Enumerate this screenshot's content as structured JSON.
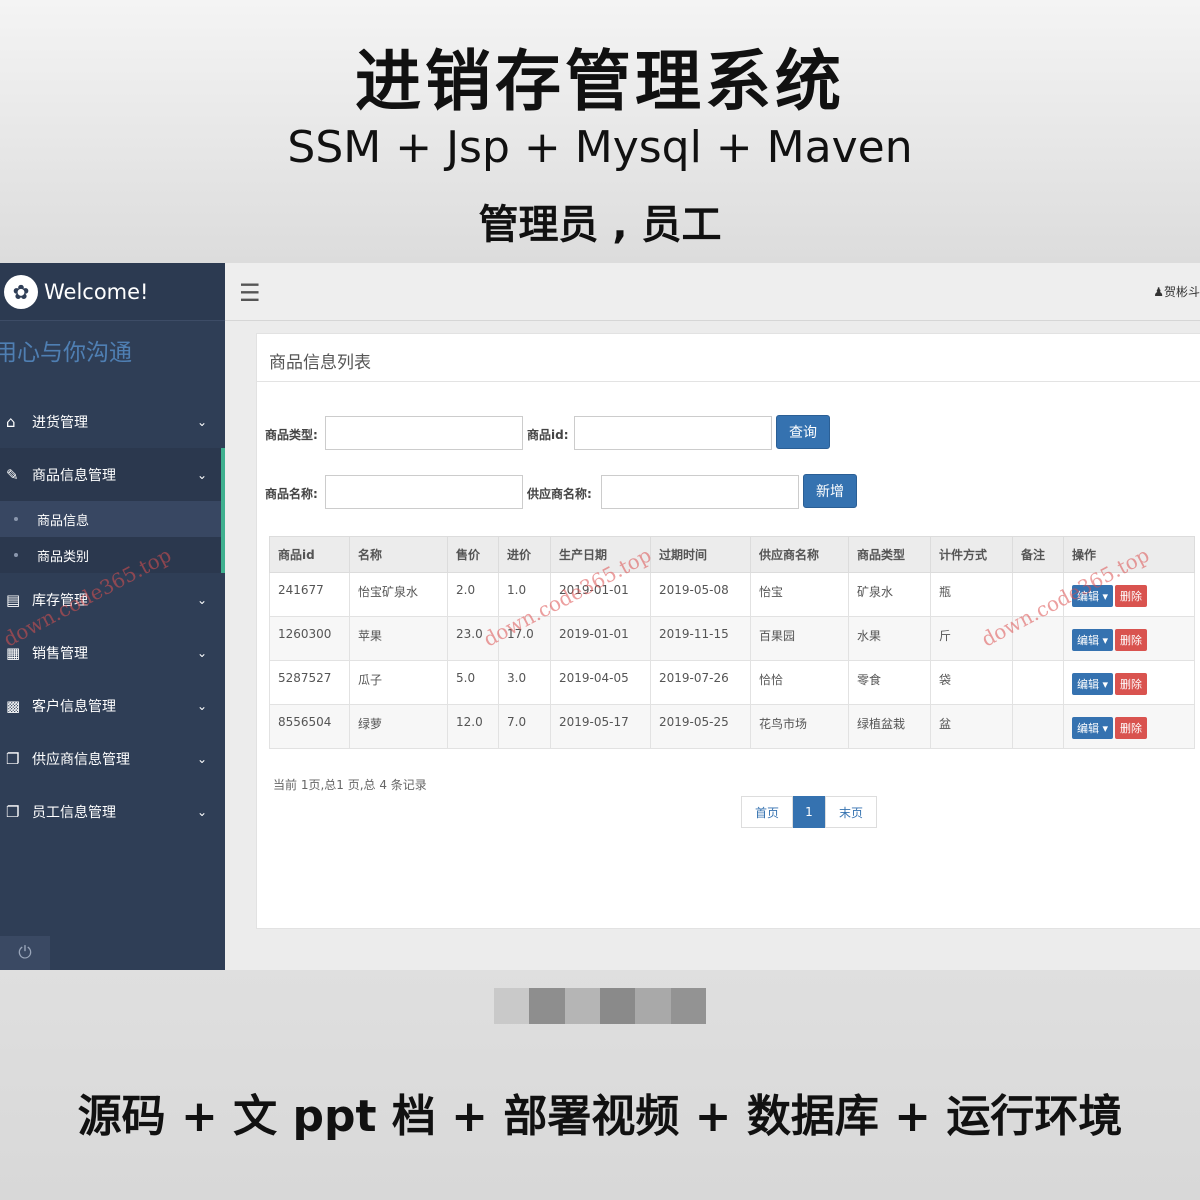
{
  "promo": {
    "title": "进销存管理系统",
    "stack": "SSM + Jsp + Mysql + Maven",
    "roles": "管理员 , 员工",
    "bottom": "源码 + 文 ppt 档 + 部署视频 + 数据库 + 运行环境"
  },
  "sidebar": {
    "brand": "Welcome!",
    "motto": "用心与你沟通",
    "items": [
      {
        "label": "进货管理",
        "icon": "home-icon"
      },
      {
        "label": "商品信息管理",
        "icon": "edit-icon"
      },
      {
        "label": "库存管理",
        "icon": "monitor-icon"
      },
      {
        "label": "销售管理",
        "icon": "grid-icon"
      },
      {
        "label": "客户信息管理",
        "icon": "bar-chart-icon"
      },
      {
        "label": "供应商信息管理",
        "icon": "copy-icon"
      },
      {
        "label": "员工信息管理",
        "icon": "copy-icon"
      }
    ],
    "sub_items": [
      "商品信息",
      "商品类别"
    ]
  },
  "header": {
    "user": "贺彬斗"
  },
  "panel": {
    "title": "商品信息列表",
    "form": {
      "type_label": "商品类型:",
      "id_label": "商品id:",
      "query_button": "查询",
      "name_label": "商品名称:",
      "supplier_label": "供应商名称:",
      "add_button": "新增"
    },
    "table": {
      "columns": [
        "商品id",
        "名称",
        "售价",
        "进价",
        "生产日期",
        "过期时间",
        "供应商名称",
        "商品类型",
        "计件方式",
        "备注",
        "操作"
      ],
      "rows": [
        [
          "241677",
          "怡宝矿泉水",
          "2.0",
          "1.0",
          "2019-01-01",
          "2019-05-08",
          "怡宝",
          "矿泉水",
          "瓶",
          ""
        ],
        [
          "1260300",
          "苹果",
          "23.0",
          "17.0",
          "2019-01-01",
          "2019-11-15",
          "百果园",
          "水果",
          "斤",
          ""
        ],
        [
          "5287527",
          "瓜子",
          "5.0",
          "3.0",
          "2019-04-05",
          "2019-07-26",
          "恰恰",
          "零食",
          "袋",
          ""
        ],
        [
          "8556504",
          "绿萝",
          "12.0",
          "7.0",
          "2019-05-17",
          "2019-05-25",
          "花鸟市场",
          "绿植盆栽",
          "盆",
          ""
        ]
      ],
      "edit_label": "编辑",
      "delete_label": "删除"
    },
    "page_info": "当前 1页,总1 页,总 4 条记录",
    "pager": {
      "first": "首页",
      "current": "1",
      "last": "末页"
    }
  },
  "watermark": "down.code365.top"
}
